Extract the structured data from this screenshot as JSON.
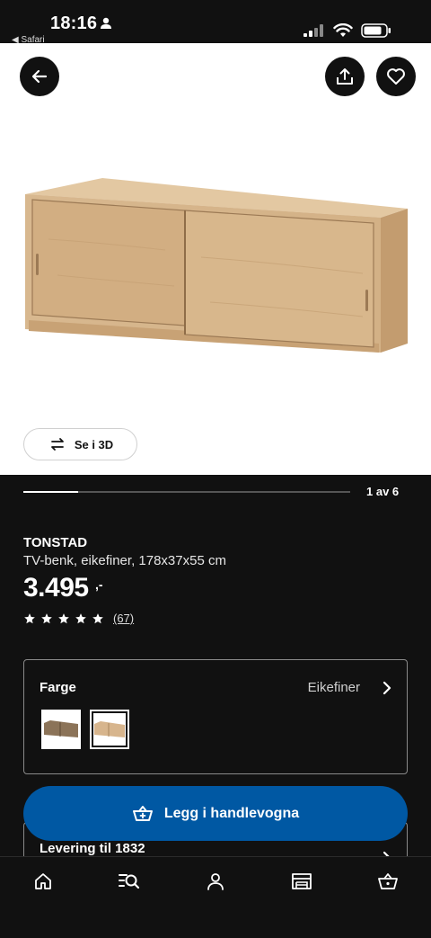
{
  "status_bar": {
    "time": "18:16",
    "back_app": "◀ Safari"
  },
  "gallery": {
    "view_3d_label": "Se i 3D",
    "position_text": "1 av 6",
    "progress": 0.1667
  },
  "product": {
    "name": "TONSTAD",
    "description": "TV-benk, eikefiner, 178x37x55 cm",
    "price": "3.495",
    "price_suffix": ",-",
    "rating_stars": 5,
    "rating_count": "(67)"
  },
  "color_selector": {
    "label": "Farge",
    "selected_value": "Eikefiner",
    "swatches": [
      {
        "name": "brown",
        "color": "#8b7358",
        "selected": false
      },
      {
        "name": "oak",
        "color": "#d7b58d",
        "selected": true
      }
    ]
  },
  "delivery": {
    "label": "Levering til 1832"
  },
  "cta": {
    "label": "Legg i handlevogna",
    "color": "#0058a3"
  },
  "colors": {
    "background": "#111111",
    "accent": "#0058a3"
  },
  "bottom_nav": {
    "items": [
      "home-icon",
      "search-list-icon",
      "profile-icon",
      "store-icon",
      "cart-icon"
    ]
  }
}
